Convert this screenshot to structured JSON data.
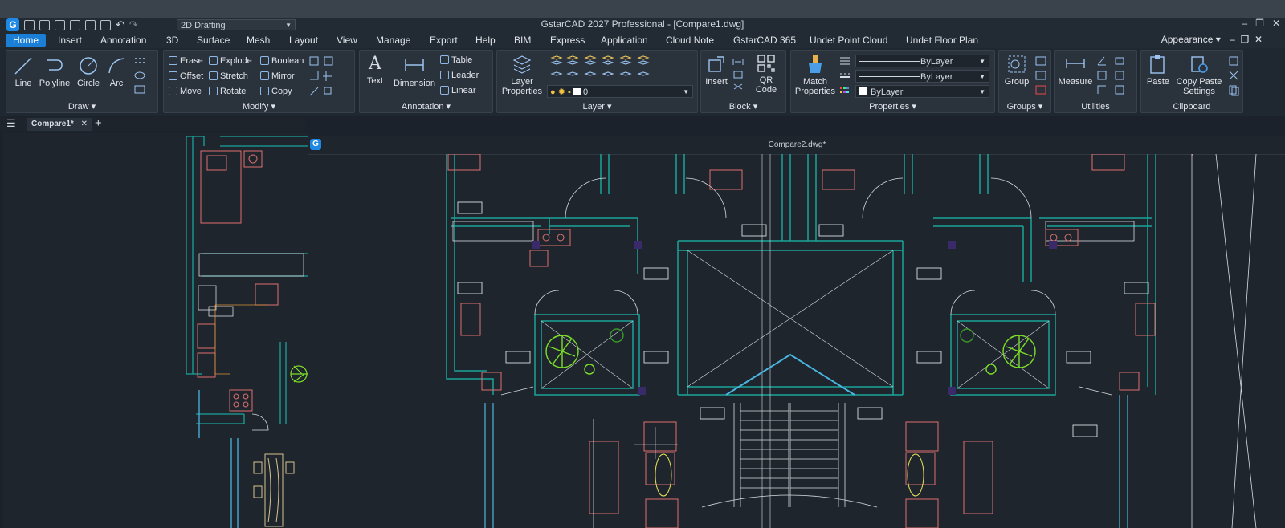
{
  "app": {
    "title": "GstarCAD 2027 Professional - [Compare1.dwg]",
    "workspace": "2D Drafting",
    "appearance": "Appearance ▾",
    "window_controls": [
      "–",
      "❐",
      "✕"
    ]
  },
  "ribbon_tabs": [
    "Home",
    "Insert",
    "Annotation",
    "3D",
    "Surface",
    "Mesh",
    "Layout",
    "View",
    "Manage",
    "Export",
    "Help",
    "BIM",
    "Express",
    "Application",
    "Cloud Note",
    "GstarCAD 365",
    "Undet Point Cloud",
    "Undet Floor Plan"
  ],
  "panels": {
    "draw": {
      "label": "Draw ▾",
      "line": "Line",
      "polyline": "Polyline",
      "circle": "Circle",
      "arc": "Arc"
    },
    "modify": {
      "label": "Modify ▾",
      "erase": "Erase",
      "explode": "Explode",
      "boolean": "Boolean",
      "offset": "Offset",
      "stretch": "Stretch",
      "mirror": "Mirror",
      "move": "Move",
      "rotate": "Rotate",
      "copy": "Copy"
    },
    "annotation": {
      "label": "Annotation ▾",
      "text": "Text",
      "dimension": "Dimension",
      "table": "Table",
      "leader": "Leader",
      "linear": "Linear"
    },
    "layer": {
      "label": "Layer ▾",
      "layer_properties": [
        "Layer",
        "Properties"
      ],
      "current_layer": "0"
    },
    "block": {
      "label": "Block ▾",
      "insert": "Insert",
      "qr_code": [
        "QR",
        "Code"
      ]
    },
    "properties": {
      "label": "Properties ▾",
      "match_properties": [
        "Match",
        "Properties"
      ],
      "linetype": "ByLayer",
      "lineweight": "ByLayer",
      "color": "ByLayer"
    },
    "groups": {
      "label": "Groups ▾",
      "group": "Group"
    },
    "utilities": {
      "label": "Utilities",
      "measure": "Measure"
    },
    "clipboard": {
      "label": "Clipboard",
      "paste": "Paste",
      "copy_paste_settings": [
        "Copy Paste",
        "Settings"
      ]
    }
  },
  "file_tabs": {
    "active": "Compare1*",
    "add": "+"
  },
  "compare_window": {
    "title": "Compare2.dwg*"
  },
  "colors": {
    "accent": "#1b7fd8",
    "wall": "#1aa39a",
    "furniture": "#e07070",
    "plant": "#7dde2a",
    "canvas": "#1e252c"
  }
}
